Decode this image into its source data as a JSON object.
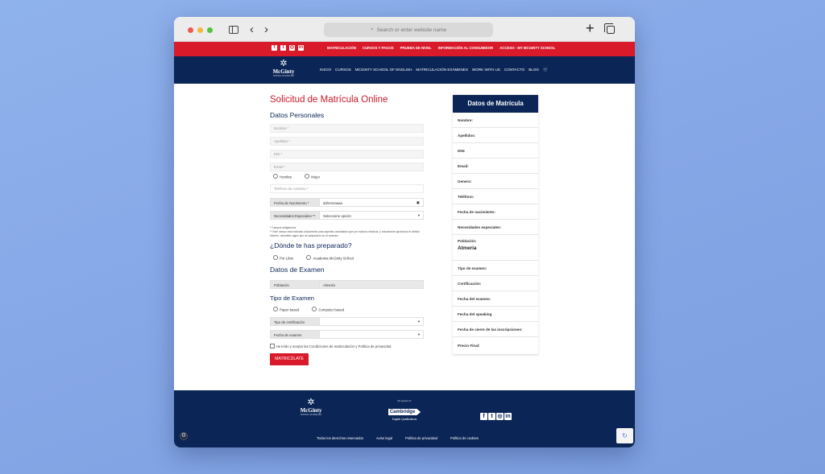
{
  "browser": {
    "address_placeholder": "Search or enter website name",
    "back_glyph": "‹",
    "forward_glyph": "›",
    "plus_glyph": "+"
  },
  "topbar": {
    "social": [
      "f",
      "t",
      "◎",
      "in"
    ],
    "links": [
      "MATRICULACIÓN",
      "CURSOS Y PAGOS",
      "PRUEBA DE NIVEL",
      "INFORMACIÓN AL CONSUMIDOR",
      "ACCESO - MY MCGINTY SCHOOL"
    ]
  },
  "nav": {
    "logo_name": "McGinty",
    "logo_tag": "SCHOOL OF ENGLISH",
    "links": [
      "INICIO",
      "CURSOS",
      "MCGINTY SCHOOL OF ENGLISH",
      "MATRICULACIÓN EXÁMENES",
      "WORK WITH US",
      "CONTACTO",
      "BLOG"
    ],
    "cart_glyph": "🛒"
  },
  "form": {
    "title": "Solicitud de Matrícula Online",
    "personal_heading": "Datos Personales",
    "name_placeholder": "Nombre *",
    "surname_placeholder": "Apellidos *",
    "dni_placeholder": "DNI *",
    "email_placeholder": "Email *",
    "gender_options": [
      "Hombre",
      "Mujer"
    ],
    "phone_placeholder": "Teléfono de contacto *",
    "birth_label": "Fecha de Nacimiento *",
    "birth_value": "dd/mm/aaaa",
    "special_label": "Necesidades Especiales **",
    "special_value": "Seleccione opción",
    "required_note": "* Campos obligatorios",
    "special_note": "** Este campo está indicado únicamente para aquellos candidatos que por motivos médicos, y únicamente aportando el debido informe, necesiten algún tipo de adaptación en el examen.",
    "prepared_heading": "¿Dónde te has preparado?",
    "prepared_options": [
      "Por Libre",
      "Academia McGinty School"
    ],
    "exam_heading": "Datos de Examen",
    "city_label": "Población",
    "city_value": "Almería",
    "exam_type_heading": "Tipo de Examen",
    "exam_type_options": [
      "Paper based",
      "Computer based"
    ],
    "cert_label": "Tipo de certificación",
    "exam_date_label": "Fecha de examen",
    "terms_text": "He leído y acepto las Condiciones de matriculación y Política de privacidad",
    "submit_label": "MATRICÚLATE"
  },
  "summary": {
    "title": "Datos de Matrícula",
    "rows": [
      {
        "label": "Nombre:",
        "value": ""
      },
      {
        "label": "Apellidos:",
        "value": ""
      },
      {
        "label": "DNI:",
        "value": ""
      },
      {
        "label": "Email:",
        "value": ""
      },
      {
        "label": "Genero:",
        "value": ""
      },
      {
        "label": "Teléfono:",
        "value": ""
      },
      {
        "label": "Fecha de nacimiento:",
        "value": ""
      },
      {
        "label": "Necesidades especiales:",
        "value": ""
      },
      {
        "label": "Población:",
        "value": "Almeria"
      },
      {
        "label": "Tipo de examen:",
        "value": ""
      },
      {
        "label": "Certificación:",
        "value": ""
      },
      {
        "label": "Fecha del examen:",
        "value": ""
      },
      {
        "label": "Fecha del speaking",
        "value": ""
      },
      {
        "label": "Fecha de cierre de las inscripciones:",
        "value": ""
      },
      {
        "label": "Precio Final:",
        "value": ""
      }
    ]
  },
  "footer": {
    "logo_name": "McGinty",
    "logo_tag": "SCHOOL OF ENGLISH",
    "cambridge_pre": "We prepare for",
    "cambridge_name": "Cambridge",
    "cambridge_sub": "English Qualifications",
    "social": [
      "f",
      "t",
      "◎",
      "in"
    ],
    "links": [
      "Todos los derechos reservados",
      "Aviso legal",
      "Política de privacidad",
      "Política de cookies"
    ]
  }
}
